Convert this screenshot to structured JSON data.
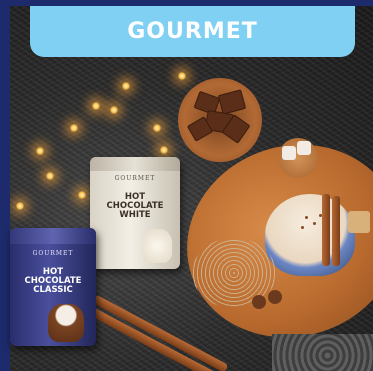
{
  "banner": {
    "label": "GOURMET",
    "color": "#7fd0f2"
  },
  "frame_color": "#1d2a6b",
  "products": [
    {
      "brand": "GOURMET",
      "name_line1": "HOT",
      "name_line2": "CHOCOLATE",
      "name_line3": "WHITE"
    },
    {
      "brand": "GOURMET",
      "name_line1": "HOT",
      "name_line2": "CHOCOLATE",
      "name_line3": "CLASSIC"
    }
  ]
}
